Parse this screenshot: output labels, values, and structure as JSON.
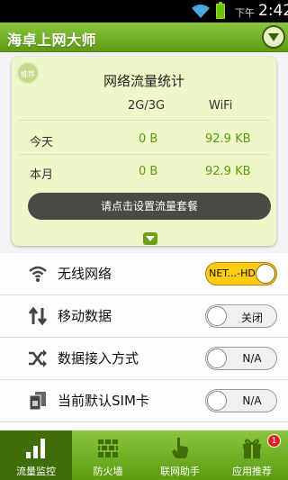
{
  "status_bar": {
    "ampm": "下午",
    "time": "2:42"
  },
  "app": {
    "title": "海卓上网大师"
  },
  "stats": {
    "badge": "推荐",
    "title": "网络流量统计",
    "col_mobile": "2G/3G",
    "col_wifi": "WiFi",
    "rows": [
      {
        "label": "今天",
        "mobile": "0 B",
        "wifi": "92.9 KB"
      },
      {
        "label": "本月",
        "mobile": "0 B",
        "wifi": "92.9 KB"
      }
    ],
    "setup_button": "请点击设置流量套餐"
  },
  "settings": [
    {
      "label": "无线网络",
      "icon": "wifi-icon",
      "toggle": "NET...-HD",
      "on": true
    },
    {
      "label": "移动数据",
      "icon": "mobile-data-icon",
      "toggle": "关闭",
      "on": false
    },
    {
      "label": "数据接入方式",
      "icon": "shuffle-icon",
      "toggle": "N/A",
      "on": false
    },
    {
      "label": "当前默认SIM卡",
      "icon": "sim-card-icon",
      "toggle": "N/A",
      "on": false
    }
  ],
  "bottom_nav": [
    {
      "label": "流量监控",
      "icon": "bar-chart-icon",
      "active": true
    },
    {
      "label": "防火墙",
      "icon": "firewall-icon",
      "active": false
    },
    {
      "label": "联网助手",
      "icon": "hand-pointer-icon",
      "active": false
    },
    {
      "label": "应用推荐",
      "icon": "gift-icon",
      "active": false,
      "badge": "1"
    }
  ],
  "colors": {
    "accent_green": "#6ac50f",
    "header_green": "#8cc53f",
    "value_green": "#5a9a0c",
    "toggle_on": "#ffcc14"
  }
}
